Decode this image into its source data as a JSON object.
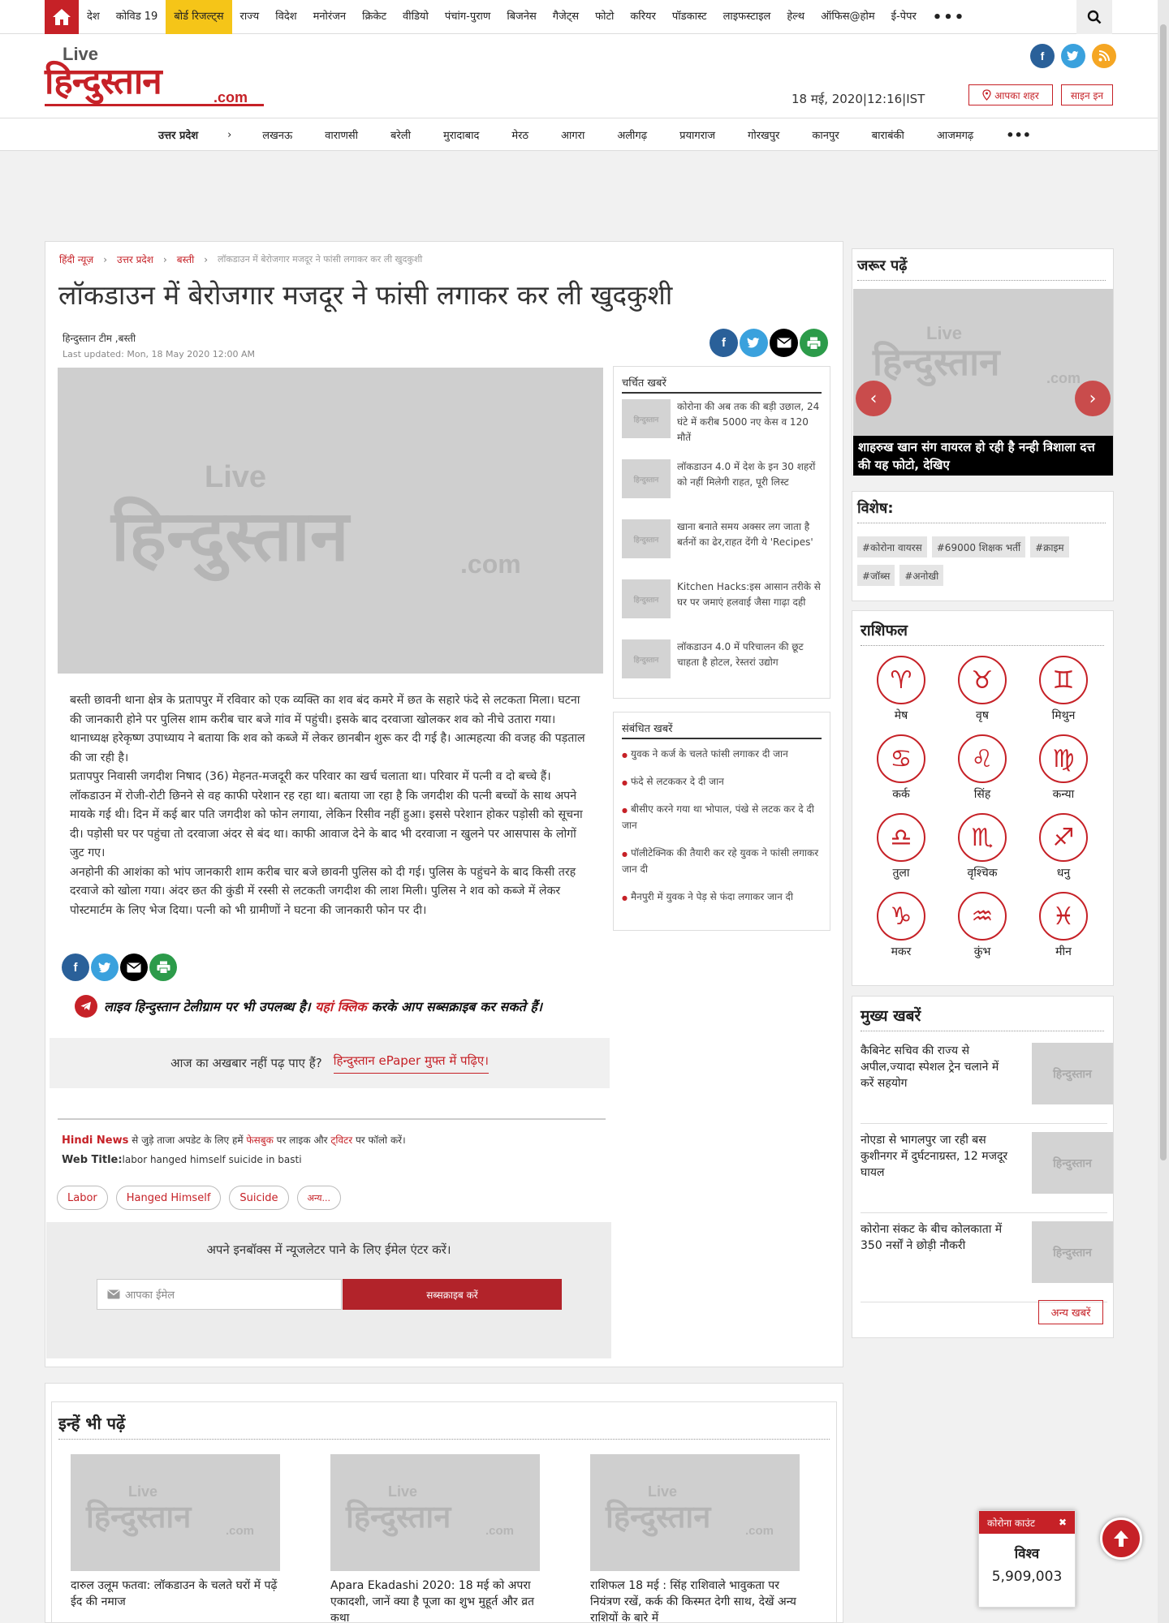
{
  "colors": {
    "brand": "#c62127",
    "highlight": "#f5c518",
    "facebook": "#2a6099",
    "twitter": "#3aa1dd",
    "rss": "#f5a623",
    "print": "#2c9b4a"
  },
  "topnav": {
    "home_icon": "home-icon",
    "items": [
      "देश",
      "कोविड 19",
      "बोर्ड रिजल्ट्स",
      "राज्य",
      "विदेश",
      "मनोरंजन",
      "क्रिकेट",
      "वीडियो",
      "पंचांग-पुराण",
      "बिजनेस",
      "गैजेट्स",
      "फोटो",
      "करियर",
      "पॉडकास्ट",
      "लाइफस्टाइल",
      "हेल्थ",
      "ऑफिस@होम",
      "ई-पेपर"
    ],
    "highlighted_item": "बोर्ड रिजल्ट्स",
    "more": "•••",
    "search_icon": "search-icon"
  },
  "header": {
    "logo_live": "Live",
    "logo_main": "हिन्दुस्तान",
    "logo_com": ".com",
    "date": "18 मई, 2020|12:16|IST",
    "city_btn": "आपका शहर",
    "signin_btn": "साइन इन"
  },
  "citynav": {
    "head": "उत्तर प्रदेश",
    "arrow": "›",
    "items": [
      "लखनऊ",
      "वाराणसी",
      "बरेली",
      "मुरादाबाद",
      "मेरठ",
      "आगरा",
      "अलीगढ़",
      "प्रयागराज",
      "गोरखपुर",
      "कानपुर",
      "बाराबंकी",
      "आजमगढ़"
    ],
    "more": "•••"
  },
  "article": {
    "crumbs": [
      "हिंदी न्यूज़",
      "उत्तर प्रदेश",
      "बस्ती"
    ],
    "crumb_sep": "›",
    "crumb_current": "लॉकडाउन में बेरोजगार मजदूर ने फांसी लगाकर कर ली खुदकुशी",
    "headline": "लॉकडाउन में बेरोजगार मजदूर ने फांसी लगाकर कर ली खुदकुशी",
    "byline": "हिन्दुस्तान टीम ,बस्ती",
    "updated": "Last updated: Mon, 18 May 2020 12:00 AM",
    "paragraphs": [
      "बस्ती छावनी थाना क्षेत्र के प्रतापपुर में रविवार को एक व्यक्ति का शव बंद कमरे में छत के सहारे फंदे से लटकता मिला। घटना की जानकारी होने पर पुलिस शाम करीब चार बजे गांव में पहुंची। इसके बाद दरवाजा खोलकर शव को नीचे उतारा गया। थानाध्यक्ष हरेकृष्ण उपाध्याय ने बताया कि शव को कब्जे में लेकर छानबीन शुरू कर दी गई है। आत्महत्या की वजह की पड़ताल की जा रही है।",
      "प्रतापपुर निवासी जगदीश निषाद (36) मेहनत-मजदूरी कर परिवार का खर्च चलाता था। परिवार में पत्नी व दो बच्चे हैं। लॉकडाउन में रोजी-रोटी छिनने से वह काफी परेशान रह रहा था। बताया जा रहा है कि जगदीश की पत्नी बच्चों के साथ अपने मायके गई थी। दिन में कई बार पति जगदीश को फोन लगाया, लेकिन रिसीव नहीं हुआ। इससे परेशान होकर पड़ोसी को सूचना दी। पड़ोसी घर पर पहुंचा तो दरवाजा अंदर से बंद था। काफी आवाज देने के बाद भी दरवाजा न खुलने पर आसपास के लोगों जुट गए।",
      "अनहोनी की आशंका को भांप जानकारी शाम करीब चार बजे छावनी पुलिस को दी गई। पुलिस के पहुंचने के बाद किसी तरह दरवाजे को खोला गया। अंदर छत की कुंडी में रस्सी से लटकती जगदीश की लाश मिली। पुलिस ने शव को कब्जे में लेकर पोस्टमार्टम के लिए भेज दिया। पत्नी को भी ग्रामीणों ने घटना की जानकारी फोन पर दी।"
    ],
    "telegram_pre": "लाइव हिन्दुस्तान टेलीग्राम पर भी उपलब्ध है।",
    "telegram_link": "यहां क्लिक",
    "telegram_post": "करके आप सब्सक्राइब कर सकते हैं।",
    "epaper_text": "आज का अखबार नहीं पढ़ पाए हैं?",
    "epaper_link": "हिन्दुस्तान ePaper मुफ्त में पढ़िए।",
    "hindi_news_label": "Hindi News",
    "hindi_news_pre": "से जुड़े ताजा अपडेट के लिए हमें",
    "hindi_news_fb": "फेसबुक",
    "hindi_news_mid": "पर लाइक और",
    "hindi_news_tw": "ट्विटर",
    "hindi_news_post": "पर फॉलो करें।",
    "web_title_label": "Web Title:",
    "web_title": "labor hanged himself suicide in basti",
    "tags": [
      "Labor",
      "Hanged Himself",
      "Suicide",
      "अन्य..."
    ],
    "newsletter_text": "अपने इनबॉक्स में न्यूजलेटर पाने के लिए ईमेल एंटर करें।",
    "newsletter_placeholder": "आपका ईमेल",
    "newsletter_btn": "सब्सक्राइब करें"
  },
  "charchit": {
    "head": "चर्चित खबरें",
    "items": [
      "कोरोना की अब तक की बड़ी उछाल, 24 घंटे में करीब 5000 नए केस व 120 मौतें",
      "लॉकडाउन 4.0 में देश के इन 30 शहरों को नहीं मिलेगी राहत, पूरी लिस्ट",
      "खाना बनाते समय अक्सर लग जाता है बर्तनों का ढेर,राहत देंगी ये 'Recipes'",
      "Kitchen Hacks:इस आसान तरीके से घर पर जमाएं हलवाई जैसा गाढ़ा दही",
      "लॉकडाउन 4.0 में परिचालन की छूट चाहता है होटल, रेस्तरां उद्योग"
    ]
  },
  "sambandh": {
    "head": "संबंधित खबरें",
    "items": [
      "युवक ने कर्ज के चलते फांसी लगाकर दी जान",
      "फंदे से लटककर दे दी जान",
      "बीसीए करने गया था भोपाल, पंखे से लटक कर दे दी जान",
      "पॉलीटेक्निक की तैयारी कर रहे युवक ने फांसी लगाकर जान दी",
      "मैनपुरी में युवक ने पेड़ से फंदा लगाकर जान दी"
    ]
  },
  "zaroor": {
    "head": "जरूर पढ़ें",
    "caption": "शाहरुख खान संग वायरल हो रही है नन्ही त्रिशाला दत्त की यह फोटो, देखिए",
    "prev": "‹",
    "next": "›"
  },
  "vishesh": {
    "head": "विशेष:",
    "tags": [
      "#कोरोना वायरस",
      "#69000 शिक्षक भर्ती",
      "#क्राइम",
      "#जॉब्स",
      "#अनोखी"
    ]
  },
  "rashifal": {
    "head": "राशिफल",
    "signs": [
      {
        "name": "मेष",
        "glyph": "♈"
      },
      {
        "name": "वृष",
        "glyph": "♉"
      },
      {
        "name": "मिथुन",
        "glyph": "♊"
      },
      {
        "name": "कर्क",
        "glyph": "♋"
      },
      {
        "name": "सिंह",
        "glyph": "♌"
      },
      {
        "name": "कन्या",
        "glyph": "♍"
      },
      {
        "name": "तुला",
        "glyph": "♎"
      },
      {
        "name": "वृश्चिक",
        "glyph": "♏"
      },
      {
        "name": "धनु",
        "glyph": "♐"
      },
      {
        "name": "मकर",
        "glyph": "♑"
      },
      {
        "name": "कुंभ",
        "glyph": "♒"
      },
      {
        "name": "मीन",
        "glyph": "♓"
      }
    ]
  },
  "mukhya": {
    "head": "मुख्य खबरें",
    "items": [
      "कैबिनेट सचिव की राज्य से अपील,ज्यादा स्पेशल ट्रेन चलाने में करें सहयोग",
      "नोएडा से भागलपुर जा रही बस कुशीनगर में दुर्घटनाग्रस्त, 12 मजदूर घायल",
      "कोरोना संकट के बीच कोलकाता में 350 नर्सों ने छोड़ी नौकरी"
    ],
    "more": "अन्य खबरें"
  },
  "inhe": {
    "head": "इन्हें भी पढ़ें",
    "items": [
      "दारुल उलूम फतवा: लॉकडाउन के चलते घरों में पढ़ें ईद की नमाज",
      "Apara Ekadashi 2020: 18 मई को अपरा एकादशी, जानें क्या है पूजा का शुभ मुहूर्त और व्रत कथा",
      "राशिफल 18 मई : सिंह राशिवाले भावुकता पर नियंत्रण रखें, कर्क की किस्मत देगी साथ, देखें अन्य राशियों के बारे में"
    ]
  },
  "corona": {
    "head": "कोरोना काउंट",
    "close": "✖",
    "region": "विश्व",
    "count": "5,909,003"
  }
}
